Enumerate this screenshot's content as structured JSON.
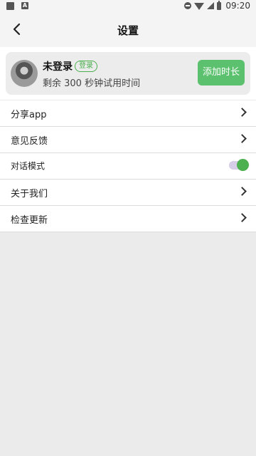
{
  "status_bar": {
    "time": "09:20",
    "left_icons": [
      "image-icon",
      "a-icon"
    ]
  },
  "header": {
    "title": "设置",
    "back_icon": "chevron-left-icon"
  },
  "profile": {
    "name": "未登录",
    "login_badge": "登录",
    "remaining_text": "剩余 300 秒钟试用时间",
    "add_time_button": "添加时长"
  },
  "menu": {
    "items": [
      {
        "label": "分享app",
        "control": "chevron"
      },
      {
        "label": "意见反馈",
        "control": "chevron"
      },
      {
        "label": "对话模式",
        "control": "toggle",
        "on": true
      },
      {
        "label": "关于我们",
        "control": "chevron"
      },
      {
        "label": "检查更新",
        "control": "chevron"
      }
    ]
  },
  "colors": {
    "accent": "#5cc16e",
    "toggle_on": "#4caf50",
    "background": "#ebebeb"
  }
}
